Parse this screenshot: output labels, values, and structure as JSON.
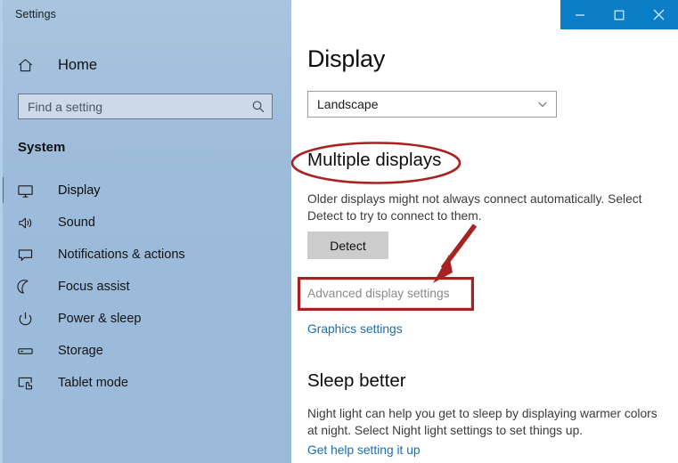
{
  "window": {
    "app_title": "Settings",
    "controls": [
      {
        "name": "minimize",
        "icon": "minimize-icon",
        "label": "Minimize"
      },
      {
        "name": "maximize",
        "icon": "maximize-icon",
        "label": "Maximize"
      },
      {
        "name": "close",
        "icon": "close-icon",
        "label": "Close"
      }
    ],
    "titlebar_color": "#0b7ec8"
  },
  "sidebar": {
    "home_label": "Home",
    "home_icon": "home-icon",
    "search": {
      "placeholder": "Find a setting",
      "value": "",
      "icon": "search-icon"
    },
    "group_label": "System",
    "accent_color": "#1478c8",
    "background_color": "#9dbbda",
    "items": [
      {
        "label": "Display",
        "icon": "monitor-icon",
        "selected": true
      },
      {
        "label": "Sound",
        "icon": "speaker-icon",
        "selected": false
      },
      {
        "label": "Notifications & actions",
        "icon": "notification-icon",
        "selected": false
      },
      {
        "label": "Focus assist",
        "icon": "moon-icon",
        "selected": false
      },
      {
        "label": "Power & sleep",
        "icon": "power-icon",
        "selected": false
      },
      {
        "label": "Storage",
        "icon": "drive-icon",
        "selected": false
      },
      {
        "label": "Tablet mode",
        "icon": "tablet-icon",
        "selected": false
      }
    ]
  },
  "main": {
    "page_title": "Display",
    "orientation_dropdown": {
      "value": "Landscape",
      "chevron_icon": "chevron-down-icon"
    },
    "multiple_displays": {
      "heading": "Multiple displays",
      "description": "Older displays might not always connect automatically. Select Detect to try to connect to them.",
      "detect_button": "Detect",
      "advanced_link": "Advanced display settings",
      "graphics_link": "Graphics settings"
    },
    "sleep_better": {
      "heading": "Sleep better",
      "description": "Night light can help you get to sleep by displaying warmer colors at night. Select Night light settings to set things up.",
      "help_link": "Get help setting it up"
    }
  },
  "annotations": {
    "color": "#a82320",
    "ellipse_target": "Multiple displays",
    "rect_target": "Advanced display settings",
    "arrow_points_to": "Advanced display settings"
  }
}
